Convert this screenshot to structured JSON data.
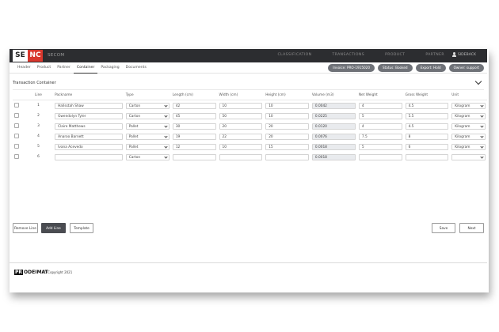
{
  "brand": {
    "left": "SE",
    "right": "NC",
    "app_name": "SECOM"
  },
  "topnav": [
    "CLASSIFICATION",
    "TRANSACTIONS",
    "PRODUCT",
    "PARTNER"
  ],
  "user": {
    "label": "SIDEBACK"
  },
  "tabs": [
    "Header",
    "Product",
    "Partner",
    "Container",
    "Packaging",
    "Documents"
  ],
  "pills": [
    "Invoice: PRO-1915020",
    "Status: Booked",
    "Export: Hold",
    "Owner: support"
  ],
  "section_title": "Transaction Container",
  "table": {
    "columns": [
      "Line",
      "Packname",
      "Type",
      "Length (cm)",
      "Width (cm)",
      "Height (cm)",
      "Volume (m3)",
      "Net Weight",
      "Gross Weight",
      "Unit"
    ],
    "rows": [
      {
        "line": "1",
        "packname": "Hallsstah Shaw",
        "type": "Carton",
        "length": "42",
        "width": "10",
        "height": "10",
        "volume": "0.0042",
        "net": "4",
        "gross": "4.5",
        "unit": "Kilogram"
      },
      {
        "line": "2",
        "packname": "Gwendolyn Tyler",
        "type": "Carton",
        "length": "45",
        "width": "50",
        "height": "10",
        "volume": "0.0225",
        "net": "5",
        "gross": "5.5",
        "unit": "Kilogram"
      },
      {
        "line": "3",
        "packname": "Claire Matthews",
        "type": "Pallet",
        "length": "30",
        "width": "20",
        "height": "20",
        "volume": "0.0120",
        "net": "4",
        "gross": "4.5",
        "unit": "Kilogram"
      },
      {
        "line": "4",
        "packname": "Anaroo Barnett",
        "type": "Pallet",
        "length": "19",
        "width": "22",
        "height": "20",
        "volume": "0.0076",
        "net": "7.5",
        "gross": "8",
        "unit": "Kilogram"
      },
      {
        "line": "5",
        "packname": "Ivana Acevedo",
        "type": "Pallet",
        "length": "12",
        "width": "10",
        "height": "15",
        "volume": "0.0018",
        "net": "5",
        "gross": "6",
        "unit": "Kilogram"
      },
      {
        "line": "6",
        "packname": "",
        "type": "Carton",
        "length": "",
        "width": "",
        "height": "",
        "volume": "0.0018",
        "net": "",
        "gross": "",
        "unit": ""
      }
    ]
  },
  "buttons": {
    "remove": "Remove Line",
    "add": "Add Line",
    "template": "Template",
    "save": "Save",
    "next": "Next"
  },
  "footer": {
    "logo_a": "PR",
    "logo_b": "ODEIMAT",
    "copyright": "© Copyright 2021"
  },
  "colors": {
    "accent": "#d8372d",
    "topbar": "#2c2d30",
    "pill": "#6f7278",
    "primary_button": "#4a4c51"
  }
}
